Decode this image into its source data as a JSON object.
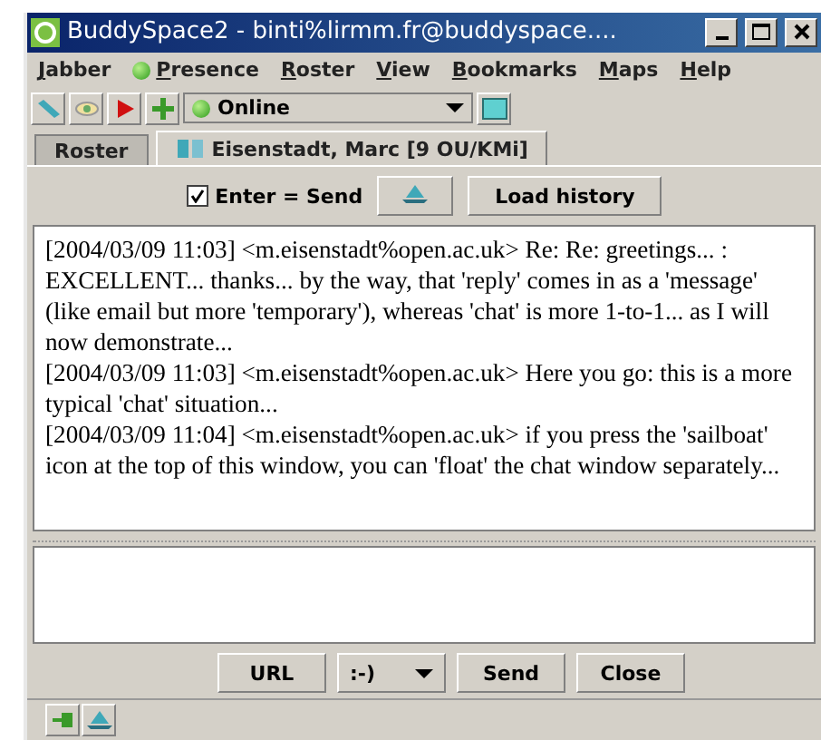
{
  "window": {
    "title": "BuddySpace2 - binti%lirmm.fr@buddyspace...."
  },
  "menu": [
    {
      "label": "Jabber",
      "kind": "text"
    },
    {
      "label": "Presence",
      "kind": "dot"
    },
    {
      "label": "Roster",
      "kind": "text"
    },
    {
      "label": "View",
      "kind": "text"
    },
    {
      "label": "Bookmarks",
      "kind": "text"
    },
    {
      "label": "Maps",
      "kind": "text"
    },
    {
      "label": "Help",
      "kind": "text"
    }
  ],
  "toolbar": {
    "status": "Online"
  },
  "tabs": [
    {
      "label": "Roster",
      "selected": false
    },
    {
      "label": "Eisenstadt, Marc [9 OU/KMi]",
      "selected": true
    }
  ],
  "chat_options": {
    "enter_send": {
      "label": "Enter = Send",
      "checked": true
    },
    "load_history": "Load history"
  },
  "messages": [
    "[2004/03/09 11:03] <m.eisenstadt%open.ac.uk> Re: Re: greetings... : EXCELLENT... thanks... by the way, that 'reply' comes in as a 'message' (like email but more 'temporary'), whereas 'chat' is more 1-to-1... as I will now demonstrate...",
    "[2004/03/09 11:03] <m.eisenstadt%open.ac.uk> Here you go: this is a more typical 'chat' situation...",
    "[2004/03/09 11:04] <m.eisenstadt%open.ac.uk> if you press the 'sailboat' icon at the top of this window, you can 'float' the chat window separately..."
  ],
  "buttons": {
    "url": "URL",
    "smiley": ":-)",
    "send": "Send",
    "close": "Close"
  }
}
